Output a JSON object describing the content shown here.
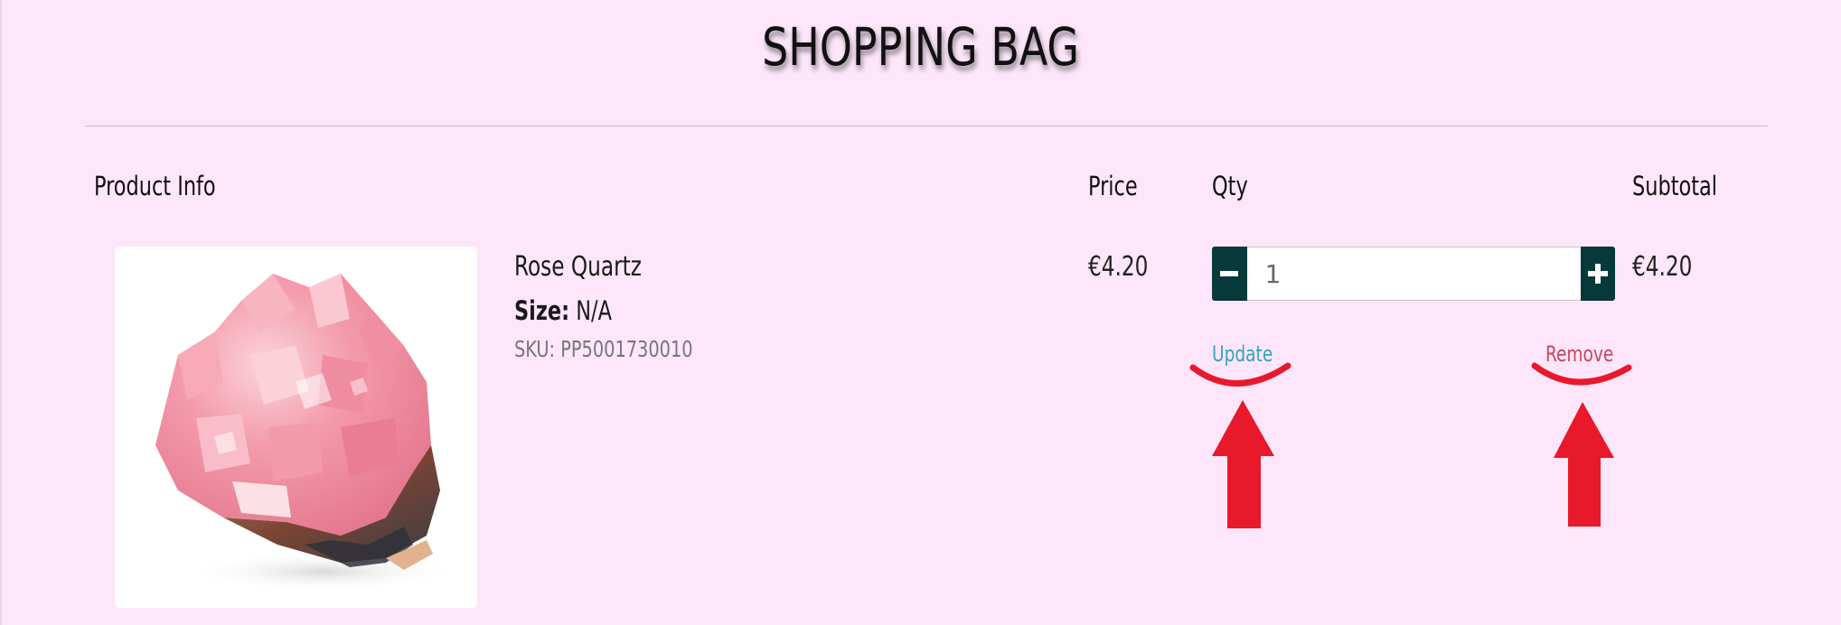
{
  "page": {
    "title": "SHOPPING BAG"
  },
  "table": {
    "headers": {
      "product_info": "Product Info",
      "price": "Price",
      "qty": "Qty",
      "subtotal": "Subtotal"
    }
  },
  "item": {
    "name": "Rose Quartz",
    "size_label": "Size:",
    "size_value": "N/A",
    "sku": "SKU: PP5001730010",
    "price": "€4.20",
    "quantity": "1",
    "subtotal": "€4.20",
    "image_alt": "Rose Quartz"
  },
  "actions": {
    "decrement_icon": "minus-icon",
    "increment_icon": "plus-icon",
    "update_label": "Update",
    "remove_label": "Remove"
  },
  "colors": {
    "page_background": "#fde6fa",
    "qty_button": "#07393a",
    "update_link": "#3aa2b8",
    "remove_link": "#c8475f",
    "annotation": "#e8192b"
  }
}
